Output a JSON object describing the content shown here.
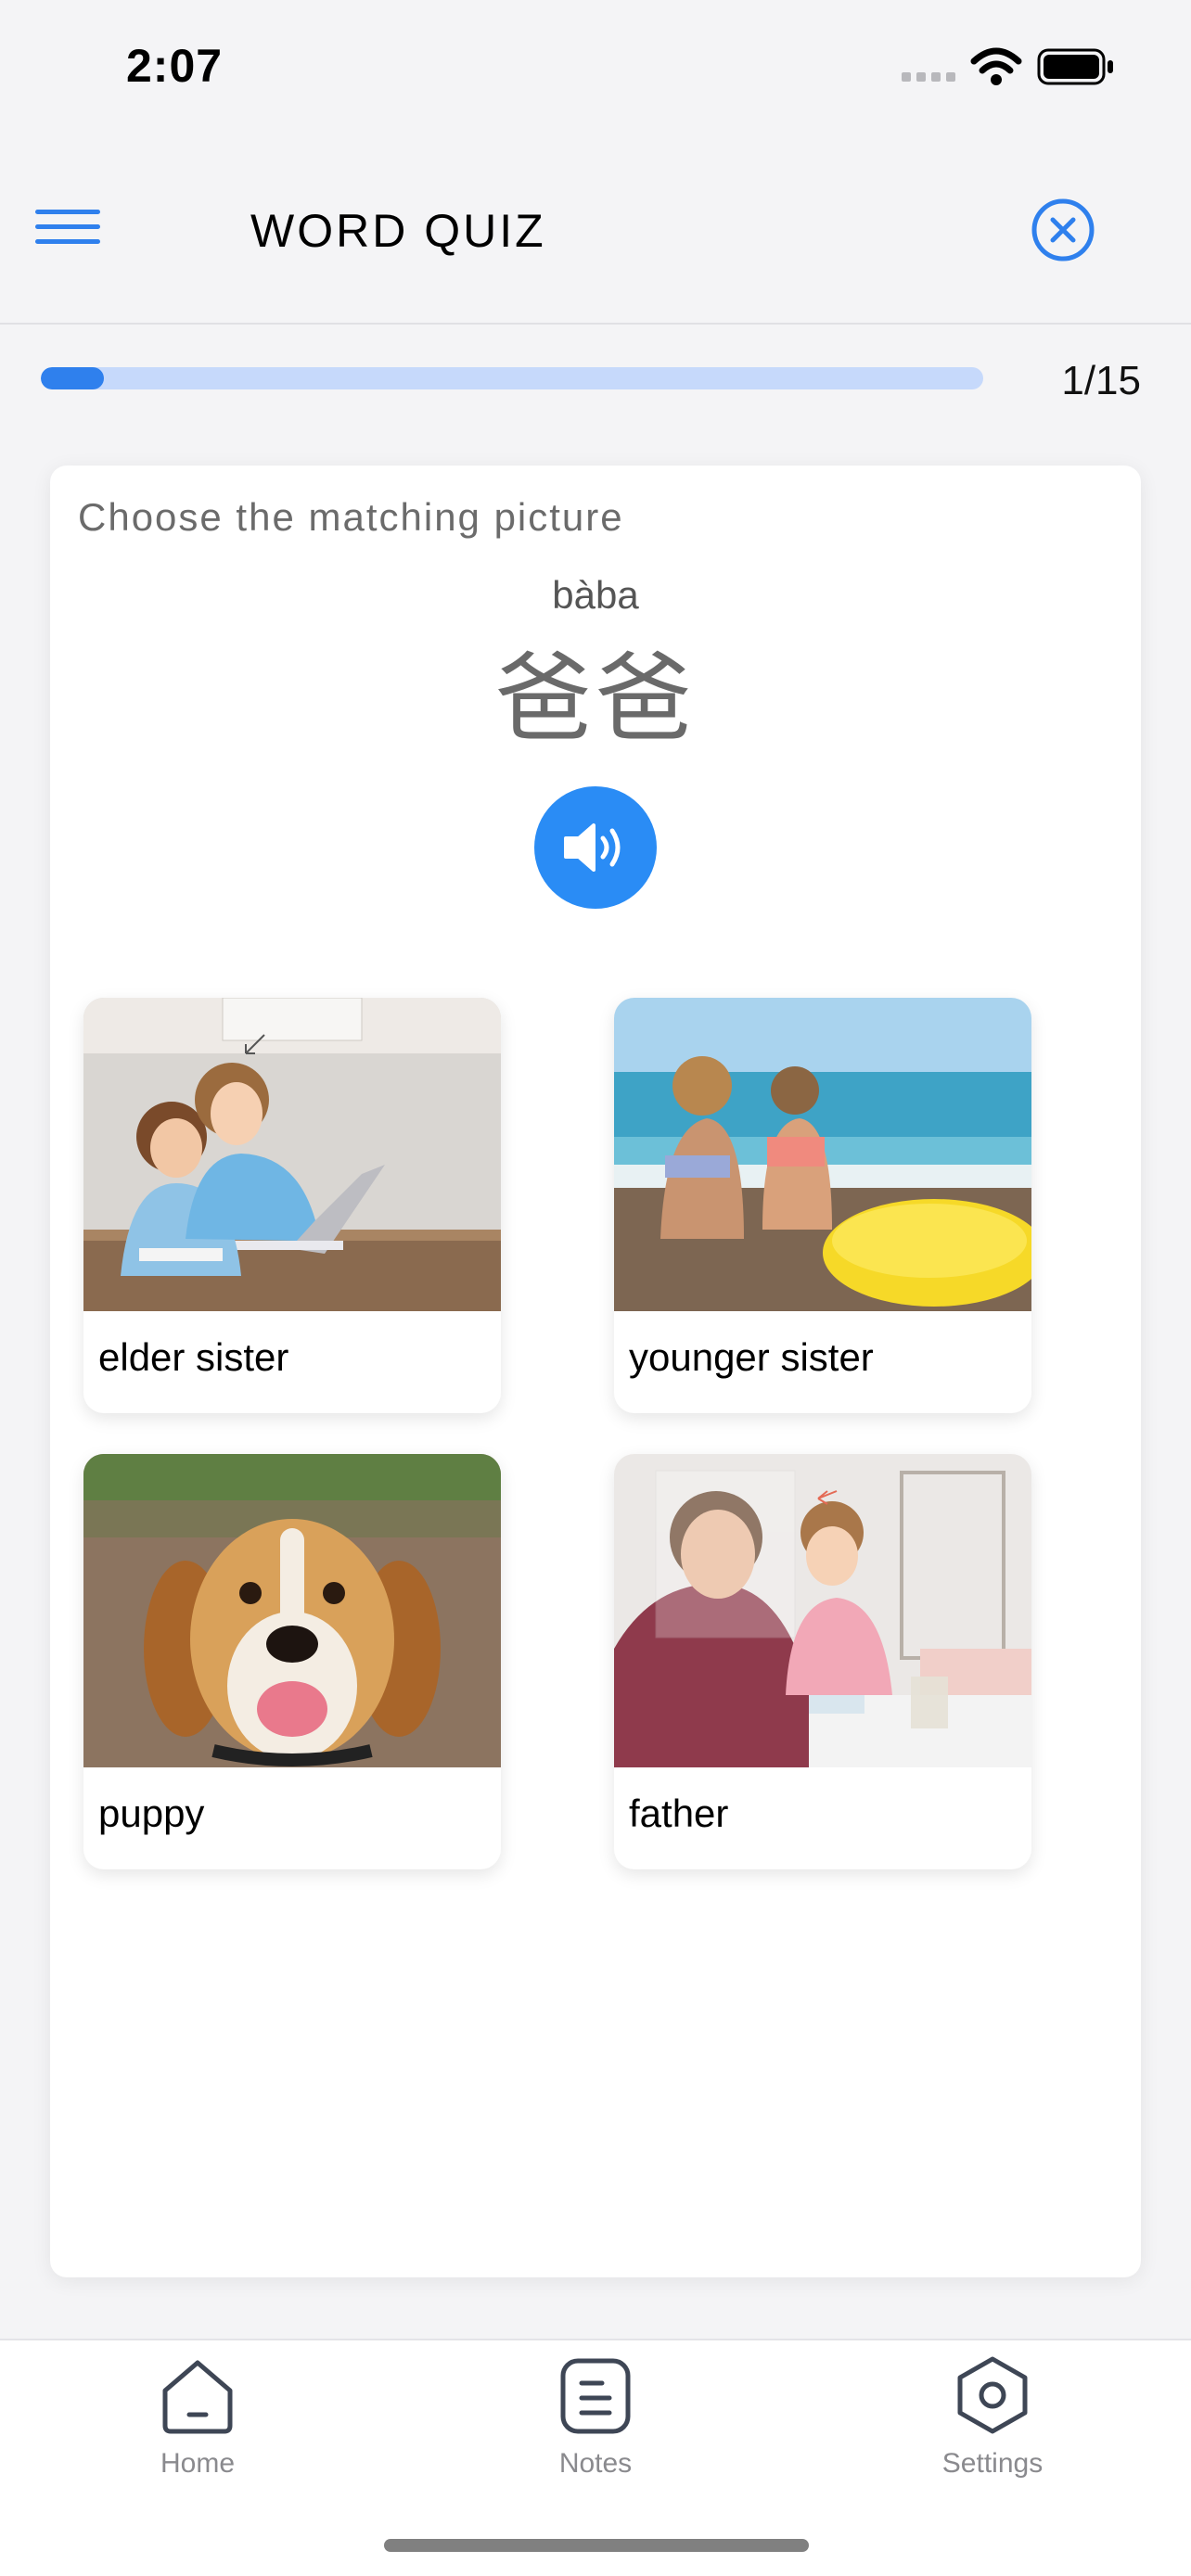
{
  "status_bar": {
    "time": "2:07"
  },
  "header": {
    "title": "WORD QUIZ"
  },
  "progress": {
    "current": 1,
    "total": 15,
    "label": "1/15",
    "fraction": 0.0667
  },
  "quiz": {
    "instruction": "Choose the matching picture",
    "pinyin": "bàba",
    "hanzi": "爸爸",
    "audio_icon": "speaker-icon"
  },
  "options": [
    {
      "label": "elder sister",
      "image": "children at laptop"
    },
    {
      "label": "younger sister",
      "image": "girls on beach"
    },
    {
      "label": "puppy",
      "image": "beagle dog"
    },
    {
      "label": "father",
      "image": "man drawing with daughter"
    }
  ],
  "tabs": [
    {
      "label": "Home",
      "icon": "home-icon"
    },
    {
      "label": "Notes",
      "icon": "notes-icon"
    },
    {
      "label": "Settings",
      "icon": "settings-icon"
    }
  ],
  "colors": {
    "accent": "#2f80ed",
    "audio_button": "#2a8cf5",
    "progress_track": "#c6d9fb"
  }
}
